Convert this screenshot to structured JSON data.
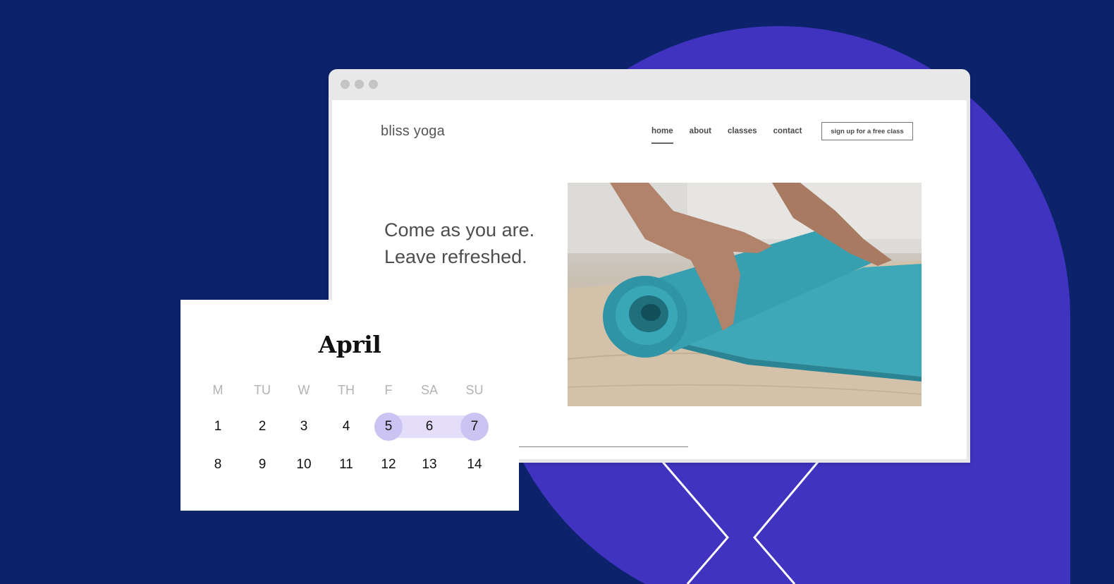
{
  "colors": {
    "background": "#0c226b",
    "accent_shape": "#3f33c0",
    "range_fill": "#e4defa",
    "range_endpoint": "#cbc4f3"
  },
  "browser": {
    "window_controls": [
      "close-dot",
      "minimize-dot",
      "maximize-dot"
    ],
    "site": {
      "brand": "bliss yoga",
      "nav": [
        {
          "label": "home",
          "active": true
        },
        {
          "label": "about",
          "active": false
        },
        {
          "label": "classes",
          "active": false
        },
        {
          "label": "contact",
          "active": false
        }
      ],
      "cta_label": "sign up for a free class",
      "headline_line1": "Come as you are.",
      "headline_line2": "Leave refreshed.",
      "hero_image": "hands rolling a teal yoga mat on a wooden floor"
    }
  },
  "calendar": {
    "month": "April",
    "weekdays": [
      "M",
      "TU",
      "W",
      "TH",
      "F",
      "SA",
      "SU"
    ],
    "weeks": [
      [
        "1",
        "2",
        "3",
        "4",
        "5",
        "6",
        "7"
      ],
      [
        "8",
        "9",
        "10",
        "11",
        "12",
        "13",
        "14"
      ]
    ],
    "selected_range": {
      "start": "5",
      "end": "7"
    }
  }
}
